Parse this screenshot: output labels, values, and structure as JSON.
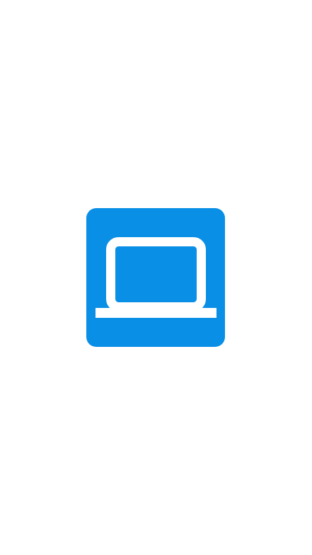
{
  "splash": {
    "icon": "laptop-icon",
    "colors": {
      "tile": "#0a8fe6",
      "glyph": "#ffffff",
      "background": "#ffffff"
    }
  }
}
